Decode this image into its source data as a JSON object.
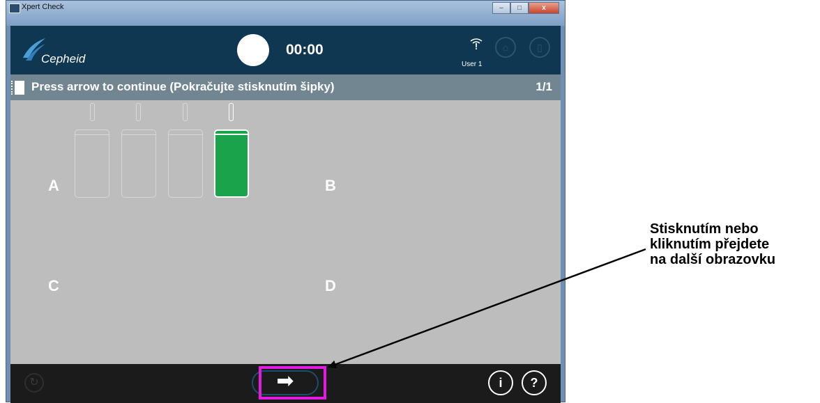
{
  "window": {
    "title": "Xpert Check",
    "controls": {
      "minimize": "‒",
      "maximize": "□",
      "close": "x"
    }
  },
  "header": {
    "brand": "Cepheid",
    "timer": "00:00",
    "network_glyph": "!",
    "user": "User 1"
  },
  "status": {
    "message": "Press arrow to continue (Pokračujte stisknutím šipky)",
    "page": "1/1"
  },
  "modules": {
    "labels": [
      "A",
      "B",
      "C",
      "D"
    ],
    "cartridge_count": 4,
    "active_cartridge_index": 3,
    "active_color": "#1aa34a"
  },
  "footer": {
    "next_glyph": "➡",
    "info_glyph": "i",
    "help_glyph": "?",
    "reload_glyph": "↻"
  },
  "annotation": {
    "lines": [
      "Stisknutím nebo",
      "kliknutím přejdete",
      "na další obrazovku"
    ],
    "highlight_color": "#e21ae2"
  }
}
